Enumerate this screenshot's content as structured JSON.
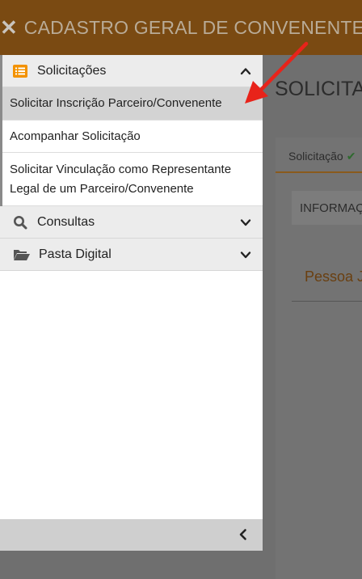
{
  "topbar": {
    "close_glyph": "✕",
    "title": "CADASTRO GERAL DE CONVENENTES"
  },
  "main": {
    "page_title": "SOLICITAÇÃO",
    "tab_label": "Solicitação",
    "tab_check": "✔",
    "info_label": "INFORMAÇÕES",
    "section_title": "Pessoa Jurídica"
  },
  "sidebar": {
    "groups": [
      {
        "label": "Solicitações",
        "icon": "list-icon",
        "expanded": true,
        "items": [
          {
            "label": "Solicitar Inscrição Parceiro/Convenente",
            "active": true
          },
          {
            "label": "Acompanhar Solicitação",
            "active": false
          },
          {
            "label_line1": "Solicitar Vinculação como Representante",
            "label_line2": "Legal de um Parceiro/Convenente",
            "active": false
          }
        ]
      },
      {
        "label": "Consultas",
        "icon": "search-icon",
        "expanded": false
      },
      {
        "label": "Pasta Digital",
        "icon": "folder-open-icon",
        "expanded": false
      }
    ]
  },
  "colors": {
    "topbar": "#7a4a12",
    "accent_orange": "#f39200",
    "annotation_red": "#e8231a",
    "active_item": "#d3d3d3"
  }
}
